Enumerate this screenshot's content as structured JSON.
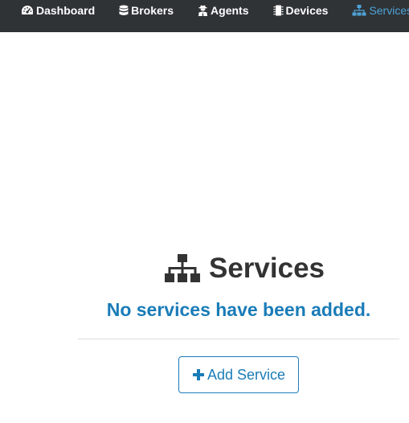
{
  "nav": {
    "items": [
      {
        "label": "Dashboard",
        "icon": "tachometer-icon",
        "active": false
      },
      {
        "label": "Brokers",
        "icon": "database-icon",
        "active": false
      },
      {
        "label": "Agents",
        "icon": "user-secret-icon",
        "active": false
      },
      {
        "label": "Devices",
        "icon": "microchip-icon",
        "active": false
      },
      {
        "label": "Services",
        "icon": "sitemap-icon",
        "active": true
      }
    ],
    "background": "#2f3336",
    "active_color": "#4ea3d8"
  },
  "main": {
    "title": "Services",
    "title_icon": "sitemap-icon",
    "empty_message": "No services have been added.",
    "add_button_label": "Add Service",
    "add_button_icon": "plus-icon",
    "accent_color": "#1a7cb8"
  }
}
